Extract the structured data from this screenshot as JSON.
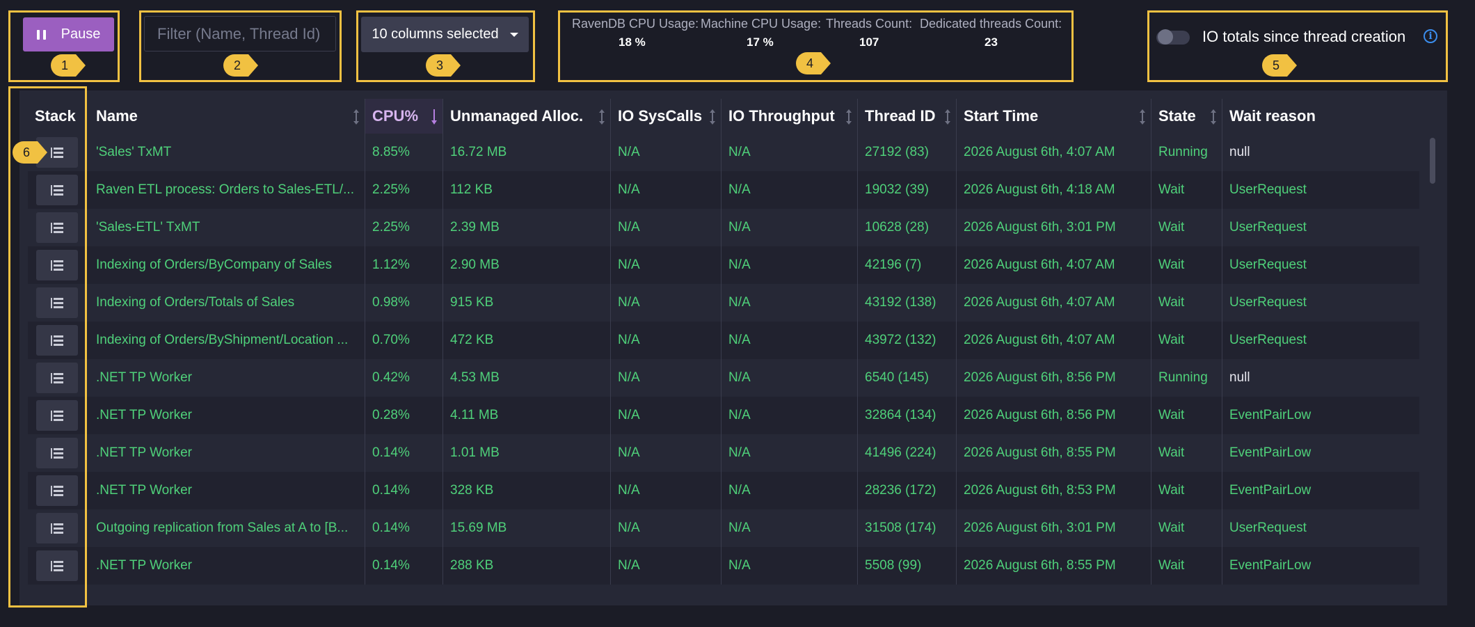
{
  "toolbar": {
    "pause_label": "Pause",
    "filter_placeholder": "Filter (Name, Thread Id)",
    "columns_label": "10 columns selected",
    "io_toggle_label": "IO totals since thread creation"
  },
  "stats": [
    {
      "label": "RavenDB CPU Usage:",
      "value": "18 %"
    },
    {
      "label": "Machine CPU Usage:",
      "value": "17 %"
    },
    {
      "label": "Threads Count:",
      "value": "107"
    },
    {
      "label": "Dedicated threads Count:",
      "value": "23"
    }
  ],
  "annotations": [
    "1",
    "2",
    "3",
    "4",
    "5",
    "6"
  ],
  "colors": {
    "accent": "#9b5fc0",
    "highlight": "#f1c142",
    "value_green": "#4fd17a",
    "info_blue": "#3b8ded"
  },
  "table": {
    "columns": [
      "Stack",
      "Name",
      "CPU%",
      "Unmanaged Alloc.",
      "IO SysCalls",
      "IO Throughput",
      "Thread ID",
      "Start Time",
      "State",
      "Wait reason"
    ],
    "sorted_column": "CPU%",
    "rows": [
      {
        "name": "'Sales' TxMT",
        "cpu": "8.85%",
        "alloc": "16.72 MB",
        "syscalls": "N/A",
        "throughput": "N/A",
        "thread_id": "27192 (83)",
        "start": "2026 August 6th, 4:07 AM",
        "state": "Running",
        "wait": "null"
      },
      {
        "name": "Raven ETL process: Orders to Sales-ETL/...",
        "cpu": "2.25%",
        "alloc": "112 KB",
        "syscalls": "N/A",
        "throughput": "N/A",
        "thread_id": "19032 (39)",
        "start": "2026 August 6th, 4:18 AM",
        "state": "Wait",
        "wait": "UserRequest"
      },
      {
        "name": "'Sales-ETL' TxMT",
        "cpu": "2.25%",
        "alloc": "2.39 MB",
        "syscalls": "N/A",
        "throughput": "N/A",
        "thread_id": "10628 (28)",
        "start": "2026 August 6th, 3:01 PM",
        "state": "Wait",
        "wait": "UserRequest"
      },
      {
        "name": "Indexing of Orders/ByCompany of Sales",
        "cpu": "1.12%",
        "alloc": "2.90 MB",
        "syscalls": "N/A",
        "throughput": "N/A",
        "thread_id": "42196 (7)",
        "start": "2026 August 6th, 4:07 AM",
        "state": "Wait",
        "wait": "UserRequest"
      },
      {
        "name": "Indexing of Orders/Totals of Sales",
        "cpu": "0.98%",
        "alloc": "915 KB",
        "syscalls": "N/A",
        "throughput": "N/A",
        "thread_id": "43192 (138)",
        "start": "2026 August 6th, 4:07 AM",
        "state": "Wait",
        "wait": "UserRequest"
      },
      {
        "name": "Indexing of Orders/ByShipment/Location ...",
        "cpu": "0.70%",
        "alloc": "472 KB",
        "syscalls": "N/A",
        "throughput": "N/A",
        "thread_id": "43972 (132)",
        "start": "2026 August 6th, 4:07 AM",
        "state": "Wait",
        "wait": "UserRequest"
      },
      {
        "name": ".NET TP Worker",
        "cpu": "0.42%",
        "alloc": "4.53 MB",
        "syscalls": "N/A",
        "throughput": "N/A",
        "thread_id": "6540 (145)",
        "start": "2026 August 6th, 8:56 PM",
        "state": "Running",
        "wait": "null"
      },
      {
        "name": ".NET TP Worker",
        "cpu": "0.28%",
        "alloc": "4.11 MB",
        "syscalls": "N/A",
        "throughput": "N/A",
        "thread_id": "32864 (134)",
        "start": "2026 August 6th, 8:56 PM",
        "state": "Wait",
        "wait": "EventPairLow"
      },
      {
        "name": ".NET TP Worker",
        "cpu": "0.14%",
        "alloc": "1.01 MB",
        "syscalls": "N/A",
        "throughput": "N/A",
        "thread_id": "41496 (224)",
        "start": "2026 August 6th, 8:55 PM",
        "state": "Wait",
        "wait": "EventPairLow"
      },
      {
        "name": ".NET TP Worker",
        "cpu": "0.14%",
        "alloc": "328 KB",
        "syscalls": "N/A",
        "throughput": "N/A",
        "thread_id": "28236 (172)",
        "start": "2026 August 6th, 8:53 PM",
        "state": "Wait",
        "wait": "EventPairLow"
      },
      {
        "name": "Outgoing replication from Sales at A to [B...",
        "cpu": "0.14%",
        "alloc": "15.69 MB",
        "syscalls": "N/A",
        "throughput": "N/A",
        "thread_id": "31508 (174)",
        "start": "2026 August 6th, 3:01 PM",
        "state": "Wait",
        "wait": "UserRequest"
      },
      {
        "name": ".NET TP Worker",
        "cpu": "0.14%",
        "alloc": "288 KB",
        "syscalls": "N/A",
        "throughput": "N/A",
        "thread_id": "5508 (99)",
        "start": "2026 August 6th, 8:55 PM",
        "state": "Wait",
        "wait": "EventPairLow"
      }
    ]
  }
}
